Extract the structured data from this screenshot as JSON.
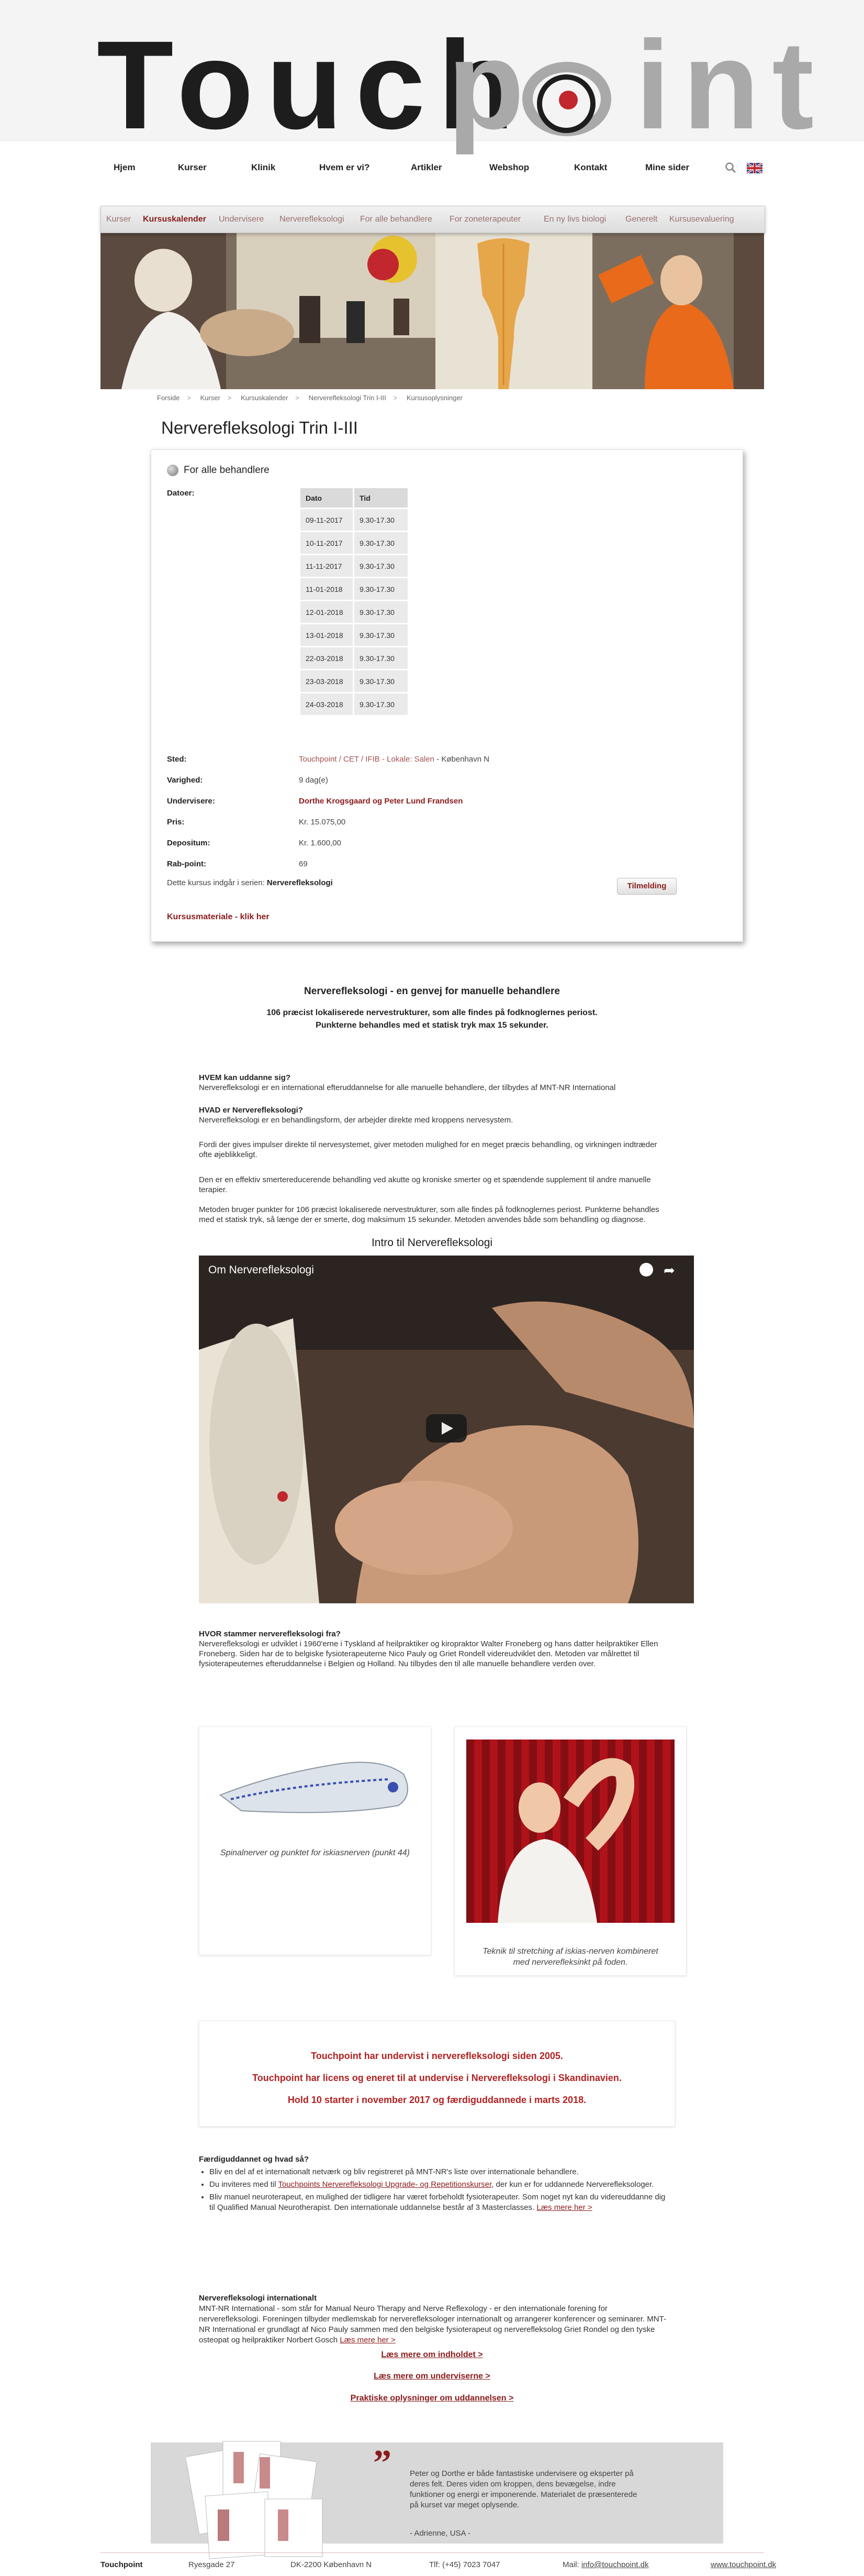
{
  "logo": {
    "part1": "Touch",
    "part2": "p",
    "part3": "int"
  },
  "nav": {
    "items": [
      "Hjem",
      "Kurser",
      "Klinik",
      "Hvem er vi?",
      "Artikler",
      "Webshop",
      "Kontakt",
      "Mine sider"
    ],
    "search_icon": "search-icon",
    "flag_icon": "uk-flag-icon"
  },
  "subnav": {
    "items": [
      "Kurser",
      "Kursuskalender",
      "Undervisere",
      "Nerverefleksologi",
      "For alle behandlere",
      "For zoneterapeuter",
      "En ny livs biologi",
      "Generelt",
      "Kursusevaluering"
    ],
    "active_index": 1
  },
  "breadcrumb": [
    "Forside",
    "Kurser",
    "Kursuskalender",
    "Nerverefleksologi Trin I-III",
    "Kursusoplysninger"
  ],
  "course": {
    "title": "Nerverefleksologi Trin I-III",
    "group": "For alle behandlere",
    "dates_label": "Datoer:",
    "dates_header": [
      "Dato",
      "Tid"
    ],
    "dates": [
      [
        "09-11-2017",
        "9.30-17.30"
      ],
      [
        "10-11-2017",
        "9.30-17.30"
      ],
      [
        "11-11-2017",
        "9.30-17.30"
      ],
      [
        "11-01-2018",
        "9.30-17.30"
      ],
      [
        "12-01-2018",
        "9.30-17.30"
      ],
      [
        "13-01-2018",
        "9.30-17.30"
      ],
      [
        "22-03-2018",
        "9.30-17.30"
      ],
      [
        "23-03-2018",
        "9.30-17.30"
      ],
      [
        "24-03-2018",
        "9.30-17.30"
      ]
    ],
    "sted_label": "Sted:",
    "sted_link": "Touchpoint / CET / IFIB - Lokale: Salen",
    "sted_city": " - København N",
    "varighed_label": "Varighed:",
    "varighed": "9 dag(e)",
    "undervisere_label": "Undervisere:",
    "undervisere": "Dorthe Krogsgaard og Peter Lund Frandsen",
    "pris_label": "Pris:",
    "pris": "Kr. 15.075,00",
    "depositum_label": "Depositum:",
    "depositum": "Kr. 1.600,00",
    "rabpoint_label": "Rab-point:",
    "rabpoint": "69",
    "included_text": "Dette kursus indgår i serien: ",
    "included_series": "Nerverefleksologi",
    "signup_button": "Tilmelding",
    "material_link": "Kursusmateriale - klik her"
  },
  "article": {
    "heading": "Nerverefleksologi - en genvej for manuelle behandlere",
    "sub1": "106 præcist lokaliserede nervestrukturer, som alle findes på fodknoglernes periost.",
    "sub2": "Punkterne behandles med et statisk tryk max 15 sekunder.",
    "hvem_q": "HVEM kan uddanne sig?",
    "hvem_a": "Nerverefleksologi er en international efteruddannelse for alle manuelle behandlere, der tilbydes af MNT-NR International",
    "hvad_q": "HVAD er Nerverefleksologi?",
    "hvad_a": "Nerverefleksologi er en behandlingsform, der arbejder direkte med kroppens nervesystem.",
    "p1": "Fordi der gives impulser direkte til nervesystemet, giver metoden mulighed for en meget præcis behandling, og virkningen indtræder ofte øjeblikkeligt.",
    "p2": "Den er en effektiv smertereducerende behandling ved akutte og kroniske smerter og et spændende supplement til andre manuelle terapier.",
    "p3": "Metoden bruger punkter for 106 præcist lokaliserede nervestrukturer, som alle findes på fodknoglernes periost. Punkterne behandles med et statisk tryk, så længe der er smerte, dog maksimum 15 sekunder. Metoden anvendes både som behandling og diagnose.",
    "video_heading": "Intro til Nerverefleksologi",
    "video_title": "Om Nerverefleksologi",
    "hvor_q": "HVOR stammer nerverefleksologi fra?",
    "hvor_a": "Nerverefleksologi er udviklet i 1960'erne i Tyskland af heilpraktiker og kiropraktor Walter Froneberg og hans datter heilpraktiker Ellen Froneberg. Siden har de to belgiske fysioterapeuterne Nico Pauly og Griet Rondell videreudviklet den. Metoden var målrettet til fysioterapeuternes efteruddannelse i Belgien og Holland. Nu tilbydes den til alle manuelle behandlere verden over.",
    "caption1": "Spinalnerver og punktet for iskiasnerven (punkt 44)",
    "caption2": "Teknik til stretching af iskias-nerven kombineret med nerverefleksinkt på foden.",
    "red1": "Touchpoint har undervist i nerverefleksologi siden 2005.",
    "red2": "Touchpoint har licens og eneret til at undervise i Nerverefleksologi i Skandinavien.",
    "red3": "Hold 10 starter i november 2017 og færdiguddannede i marts 2018.",
    "faerdig_q": "Færdiguddannet og hvad så?",
    "faerdig_li1": "Bliv en del af et internationalt netværk og bliv registreret på MNT-NR's liste over internationale behandlere.",
    "faerdig_li2a": "Du inviteres med til ",
    "faerdig_li2_link": "Touchpoints Nerverefleksologi Upgrade- og Repetitionskurser",
    "faerdig_li2b": ", der kun er for uddannede Nerverefleksologer.",
    "faerdig_li3": "Bliv manuel neuroterapeut, en mulighed der tidligere har været forbeholdt fysioterapeuter. Som noget nyt kan du videreuddanne dig til Qualified Manual Neurotherapist. Den internationale uddannelse består af 3 Masterclasses. ",
    "faerdig_li3_link": "Læs mere her >",
    "intl_q": "Nerverefleksologi internationalt",
    "intl_a": "MNT-NR International - som står for Manual Neuro Therapy and Nerve Reflexology - er den internationale forening for nerverefleksologi. Foreningen tilbyder medlemskab for nerverefleksologer internationalt og arrangerer konferencer og seminarer. MNT-NR International er grundlagt af Nico Pauly sammen med den belgiske fysioterapeut og nerverefleksolog Griet Rondel og den tyske osteopat og heilpraktiker Norbert Gosch ",
    "intl_link": "Læs mere her >",
    "link_indhold": "Læs mere om indholdet >",
    "link_undervisere": "Læs mere om underviserne >",
    "link_praktisk": "Praktiske oplysninger om uddannelsen >"
  },
  "testimonial": {
    "text": "Peter og Dorthe er både fantastiske undervisere og eksperter på deres felt. Deres viden om kroppen, dens bevægelse, indre funktioner og energi er imponerende. Materialet de præsenterede på kurset var meget oplysende.",
    "author": "- Adrienne, USA -"
  },
  "footer": {
    "name": "Touchpoint",
    "address": "Ryesgade 27",
    "city": "DK-2200 København N",
    "phone": "Tlf: (+45) 7023 7047",
    "mail_label": "Mail: ",
    "mail": "info@touchpoint.dk",
    "web": "www.touchpoint.dk"
  },
  "colors": {
    "brand_red": "#8a1c1c",
    "accent_red": "#b22222",
    "logo_dark": "#1d1d1d",
    "logo_grey": "#a9a9a9"
  }
}
